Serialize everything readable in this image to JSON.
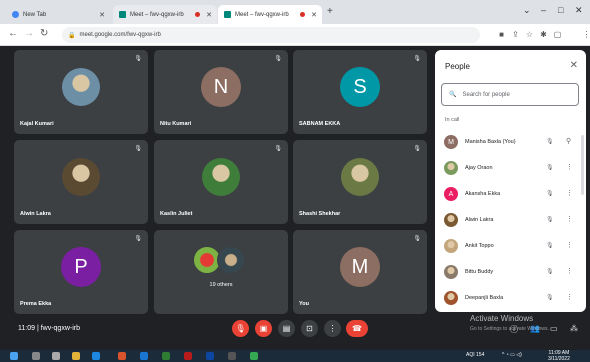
{
  "browser": {
    "tabs": [
      {
        "label": "New Tab"
      },
      {
        "label": "Meet – fwv-qgxw-irb"
      },
      {
        "label": "Meet – fwv-qgxw-irb"
      }
    ],
    "new_tab": "+",
    "url": "meet.google.com/fwv-qgxw-irb",
    "window_controls": {
      "minimize": "–",
      "maximize": "□",
      "close": "✕"
    }
  },
  "tiles": [
    {
      "name": "Kajal Kumari",
      "kind": "photo",
      "color": "#6d8fa6"
    },
    {
      "name": "Nitu Kumari",
      "kind": "initial",
      "initial": "N",
      "color": "#8d6e63"
    },
    {
      "name": "SABNAM EKKA",
      "kind": "initial",
      "initial": "S",
      "color": "#0097a7"
    },
    {
      "name": "Alwin Lakra",
      "kind": "photo",
      "color": "#5b4a32"
    },
    {
      "name": "Kaslin Juliet",
      "kind": "photo",
      "color": "#3f7d3a"
    },
    {
      "name": "Shashi Shekhar",
      "kind": "photo",
      "color": "#6b7a45"
    },
    {
      "name": "Prema Ekka",
      "kind": "initial",
      "initial": "P",
      "color": "#7b1fa2"
    },
    {
      "name": "",
      "kind": "others",
      "others_label": "19 others"
    },
    {
      "name": "You",
      "kind": "initial",
      "initial": "M",
      "color": "#8d6e63"
    }
  ],
  "meeting": {
    "code": "11:09 | fwv-qgxw-irb"
  },
  "people_panel": {
    "title": "People",
    "search_placeholder": "Search for people",
    "section_label": "In call",
    "people": [
      {
        "name": "Manisha Baxla (You)",
        "initial": "M",
        "color": "#8d6e63"
      },
      {
        "name": "Ajay Oraon",
        "initial": "",
        "color": "#7a9a5e"
      },
      {
        "name": "Akansha Ekka",
        "initial": "A",
        "color": "#e91e63"
      },
      {
        "name": "Alwin Lakra",
        "initial": "",
        "color": "#7a5a32"
      },
      {
        "name": "Ankit Toppo",
        "initial": "",
        "color": "#c2a57a"
      },
      {
        "name": "Bittu Buddy",
        "initial": "",
        "color": "#8a7a6a"
      },
      {
        "name": "Deepanjli Baxla",
        "initial": "",
        "color": "#a0522d"
      }
    ]
  },
  "watermark": {
    "title": "Activate Windows",
    "subtitle": "Go to Settings to activate Windows."
  },
  "taskbar": {
    "aqi": "AQI 154",
    "time": "11:09 AM",
    "date": "3/11/2022"
  }
}
